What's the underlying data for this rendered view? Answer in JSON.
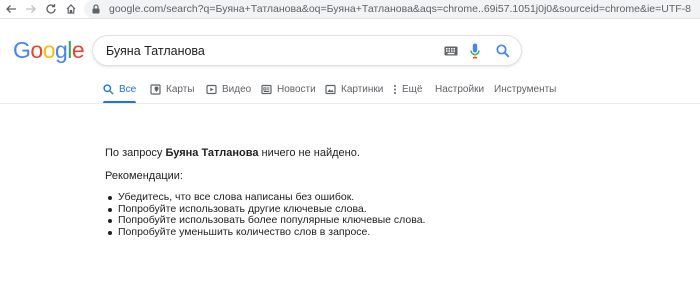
{
  "browser": {
    "url": "google.com/search?q=Буяна+Татланова&oq=Буяна+Татланова&aqs=chrome..69i57.1051j0j0&sourceid=chrome&ie=UTF-8",
    "icons": [
      "back-arrow-icon",
      "forward-arrow-icon",
      "reload-icon",
      "home-icon",
      "lock-icon"
    ]
  },
  "logo": {
    "letters": [
      "G",
      "o",
      "o",
      "g",
      "l",
      "e"
    ],
    "colors": [
      "#4285f4",
      "#ea4335",
      "#fbbc05",
      "#4285f4",
      "#34a853",
      "#ea4335"
    ]
  },
  "search": {
    "query": "Буяна Татланова",
    "icons": [
      "keyboard-icon",
      "microphone-icon",
      "search-icon"
    ]
  },
  "tabs": [
    {
      "label": "Все",
      "icon": "search-icon",
      "active": true
    },
    {
      "label": "Карты",
      "icon": "map-icon",
      "active": false
    },
    {
      "label": "Видео",
      "icon": "video-icon",
      "active": false
    },
    {
      "label": "Новости",
      "icon": "news-icon",
      "active": false
    },
    {
      "label": "Картинки",
      "icon": "image-icon",
      "active": false
    },
    {
      "label": "Ещё",
      "icon": "more-dots-icon",
      "active": false
    },
    {
      "label": "Настройки",
      "active": false
    },
    {
      "label": "Инструменты",
      "active": false
    }
  ],
  "results": {
    "no_results_prefix": "По запросу ",
    "no_results_query": "Буяна Татланова",
    "no_results_suffix": " ничего не найдено.",
    "recommendations_label": "Рекомендации:",
    "recommendations": [
      "Убедитесь, что все слова написаны без ошибок.",
      "Попробуйте использовать другие ключевые слова.",
      "Попробуйте использовать более популярные ключевые слова.",
      "Попробуйте уменьшить количество слов в запросе."
    ]
  },
  "colors": {
    "accent": "#1a73e8",
    "tab_text": "#5f6368",
    "body_text": "#202124"
  }
}
